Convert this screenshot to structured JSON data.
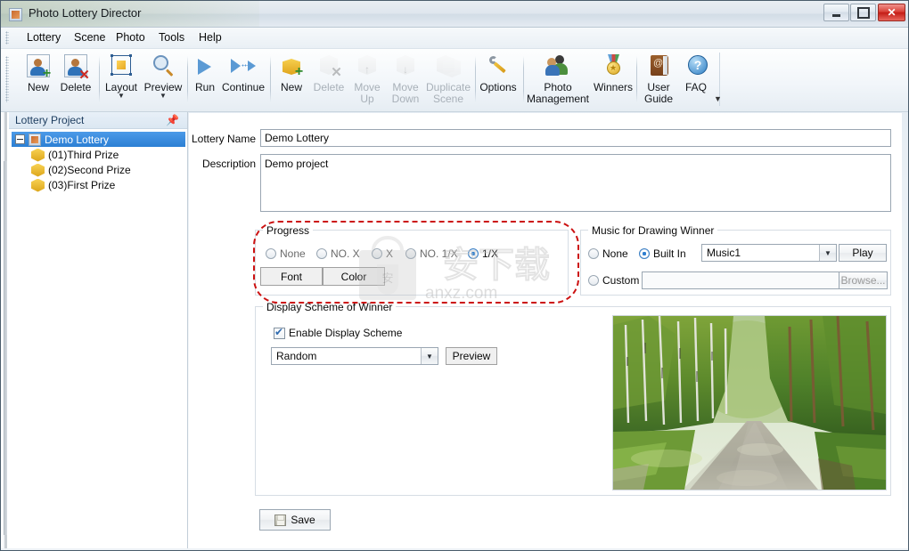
{
  "window": {
    "title": "Photo Lottery Director",
    "app_icon": "app-icon",
    "minimize_label": "—",
    "maximize_label": "▫",
    "close_label": "✕"
  },
  "menu": {
    "items": [
      {
        "label": "Lottery"
      },
      {
        "label": "Scene"
      },
      {
        "label": "Photo"
      },
      {
        "label": "Tools"
      },
      {
        "label": "Help"
      }
    ]
  },
  "toolbar": {
    "overflow_label": "▼",
    "buttons": [
      {
        "label": "New",
        "icon": "user-add-icon",
        "enabled": true,
        "dropdown": false
      },
      {
        "label": "Delete",
        "icon": "user-delete-icon",
        "enabled": true,
        "dropdown": false
      },
      {
        "label": "Layout",
        "icon": "layout-icon",
        "enabled": true,
        "dropdown": true
      },
      {
        "label": "Preview",
        "icon": "magnifier-icon",
        "enabled": true,
        "dropdown": true
      },
      {
        "label": "Run",
        "icon": "play-icon",
        "enabled": true,
        "dropdown": false
      },
      {
        "label": "Continue",
        "icon": "play-continue-icon",
        "enabled": true,
        "dropdown": false
      },
      {
        "label": "New",
        "icon": "cube-add-icon",
        "enabled": true,
        "dropdown": false
      },
      {
        "label": "Delete",
        "icon": "cube-delete-icon",
        "enabled": false,
        "dropdown": false
      },
      {
        "label": "Move\nUp",
        "icon": "cube-move-up-icon",
        "enabled": false,
        "dropdown": false
      },
      {
        "label": "Move\nDown",
        "icon": "cube-move-down-icon",
        "enabled": false,
        "dropdown": false
      },
      {
        "label": "Duplicate\nScene",
        "icon": "cube-duplicate-icon",
        "enabled": false,
        "dropdown": false
      },
      {
        "label": "Options",
        "icon": "wrench-icon",
        "enabled": true,
        "dropdown": false
      },
      {
        "label": "Photo\nManagement",
        "icon": "people-icon",
        "enabled": true,
        "dropdown": false
      },
      {
        "label": "Winners",
        "icon": "medal-icon",
        "enabled": true,
        "dropdown": false
      },
      {
        "label": "User\nGuide",
        "icon": "book-icon",
        "enabled": true,
        "dropdown": false
      },
      {
        "label": "FAQ",
        "icon": "faq-icon",
        "enabled": true,
        "dropdown": false
      }
    ]
  },
  "left_panel": {
    "title": "Lottery Project",
    "pin_icon": "pin-icon",
    "tree": {
      "root": {
        "label": "Demo Lottery",
        "icon": "app-icon",
        "selected": true,
        "expanded": true
      },
      "children": [
        {
          "label": "(01)Third Prize",
          "icon": "cube-icon"
        },
        {
          "label": "(02)Second Prize",
          "icon": "cube-icon"
        },
        {
          "label": "(03)First Prize",
          "icon": "cube-icon"
        }
      ]
    }
  },
  "form": {
    "lottery_name_label": "Lottery Name",
    "lottery_name_value": "Demo Lottery",
    "description_label": "Description",
    "description_value": "Demo project",
    "progress": {
      "title": "Progress",
      "options": [
        {
          "label": "None",
          "selected": false,
          "dim": true
        },
        {
          "label": "NO. X",
          "selected": false,
          "dim": true
        },
        {
          "label": "X",
          "selected": false,
          "dim": true
        },
        {
          "label": "NO. 1/X",
          "selected": false,
          "dim": true
        },
        {
          "label": "1/X",
          "selected": true,
          "dim": false
        }
      ],
      "font_button": "Font",
      "color_button": "Color"
    },
    "music": {
      "title": "Music for Drawing Winner",
      "none_label": "None",
      "none_selected": false,
      "builtin_label": "Built In",
      "builtin_selected": true,
      "builtin_value": "Music1",
      "play_button": "Play",
      "custom_label": "Custom",
      "custom_selected": false,
      "custom_value": "",
      "browse_button": "Browse..."
    },
    "display_scheme": {
      "title": "Display Scheme of Winner",
      "enable_label": "Enable Display Scheme",
      "enable_checked": true,
      "scheme_value": "Random",
      "preview_button": "Preview"
    },
    "save_button": "Save"
  },
  "watermark": {
    "chinese": "安下载",
    "domain": "anxz.com"
  },
  "photo": {
    "alt": "forest-path-photo"
  },
  "colors": {
    "accent_blue": "#2b7fd4",
    "highlight_red": "#cc1111",
    "close_red": "#c41c16",
    "title_text": "#15191d"
  }
}
